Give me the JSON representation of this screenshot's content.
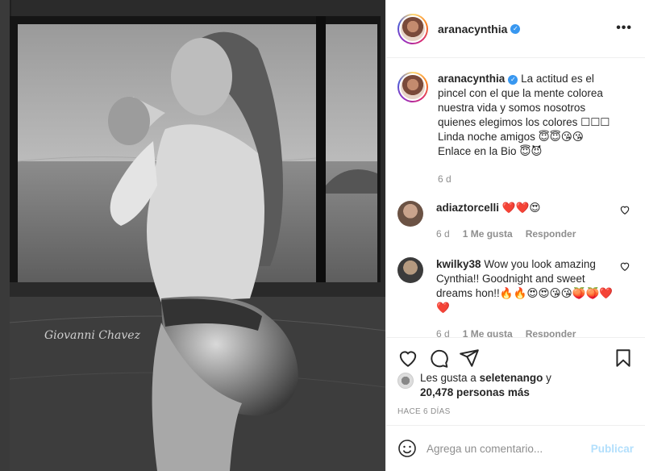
{
  "colors": {
    "verified": "#3897f0",
    "heart": "#ed4956",
    "muted": "#8e8e8e",
    "publish": "#b2dffc"
  },
  "post": {
    "username": "aranacynthia",
    "verified_mark": "✓",
    "more_icon": "•••",
    "watermark": "Giovanni Chavez"
  },
  "caption": {
    "username": "aranacynthia",
    "text": "La actitud es el pincel con el que la mente colorea nuestra vida y somos nosotros quienes elegimos los colores ☐☐☐ Linda noche amigos 😇😇😘😘 Enlace en la Bio 😇😈",
    "time": "6 d"
  },
  "comments": [
    {
      "username": "adiaztorcelli",
      "text": "❤️❤️😍",
      "time": "6 d",
      "likes": "1 Me gusta",
      "reply": "Responder"
    },
    {
      "username": "kwilky38",
      "text": "Wow you look amazing Cynthia!! Goodnight and sweet dreams hon!!🔥🔥😍😍😘😘🍑🍑❤️❤️",
      "time": "6 d",
      "likes": "1 Me gusta",
      "reply": "Responder"
    }
  ],
  "likes": {
    "prefix": "Les gusta a ",
    "user": "seletenango",
    "mid": " y",
    "count": "20,478 personas más"
  },
  "timestamp": "HACE 6 DÍAS",
  "composer": {
    "placeholder": "Agrega un comentario...",
    "publish": "Publicar"
  }
}
